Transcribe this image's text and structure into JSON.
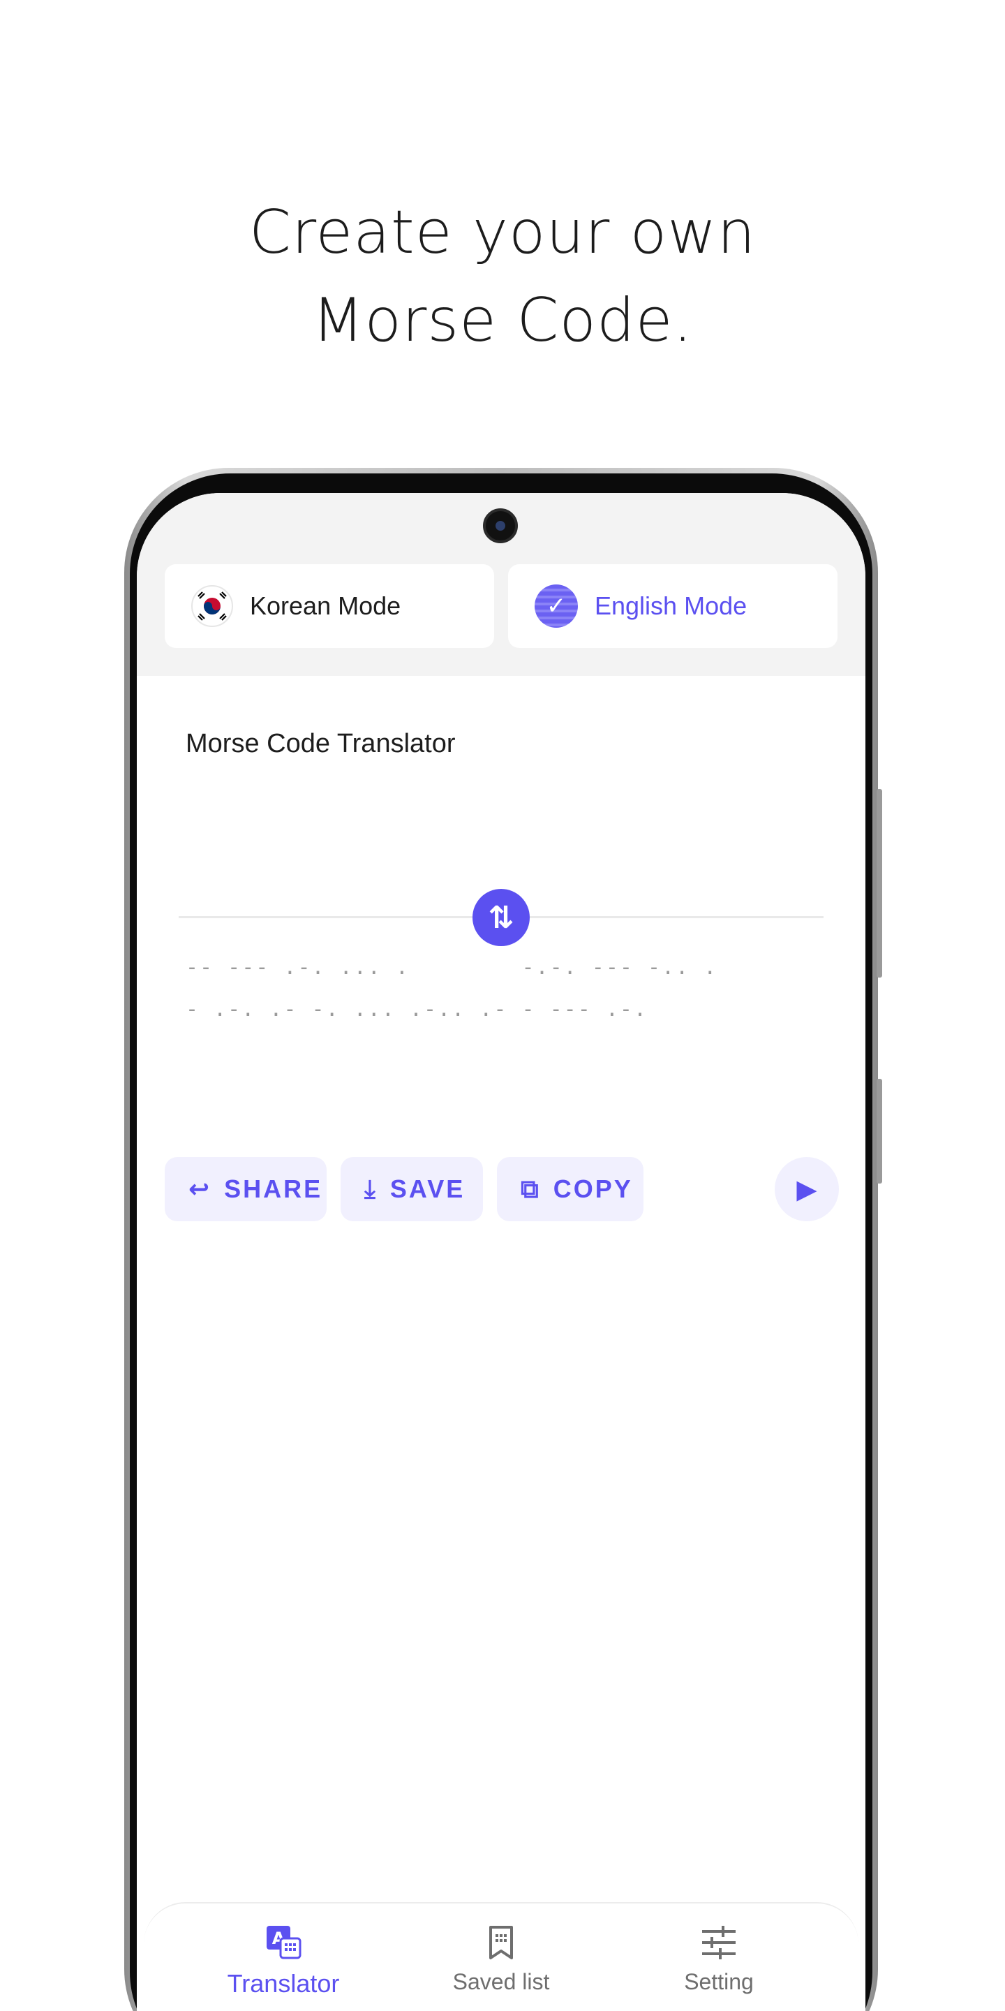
{
  "headline": {
    "line1": "Create your own",
    "line2": "Morse Code."
  },
  "modes": {
    "korean": {
      "label": "Korean Mode"
    },
    "english": {
      "label": "English Mode"
    }
  },
  "translator": {
    "title": "Morse Code Translator",
    "output": "-- --- .-. ... .        -.-. --- -.. .        - .-. .- -. ... .-.. .- - --- .-."
  },
  "actions": {
    "share": "SHARE",
    "save": "SAVE",
    "copy": "COPY"
  },
  "nav": {
    "translator": "Translator",
    "saved": "Saved list",
    "setting": "Setting"
  },
  "colors": {
    "accent": "#5b50f0",
    "accent_soft": "#f1f0fe"
  }
}
